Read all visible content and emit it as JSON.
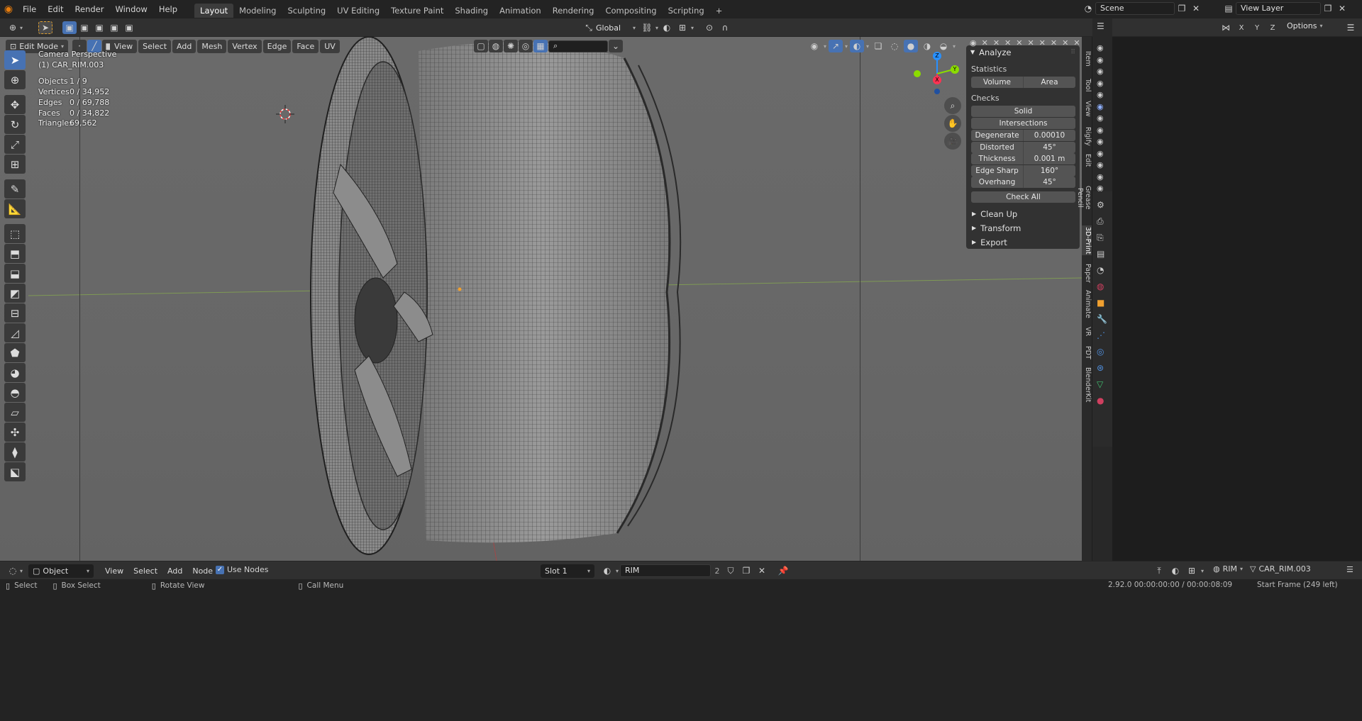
{
  "topbar": {
    "menus": [
      "File",
      "Edit",
      "Render",
      "Window",
      "Help"
    ],
    "workspaces": [
      "Layout",
      "Modeling",
      "Sculpting",
      "UV Editing",
      "Texture Paint",
      "Shading",
      "Animation",
      "Rendering",
      "Compositing",
      "Scripting"
    ],
    "active_workspace": "Layout",
    "add_tab_icon": "+",
    "scene": "Scene",
    "view_layer": "View Layer"
  },
  "viewport_header": {
    "transform_orientation": "Global",
    "options_label": "Options",
    "axes": [
      "X",
      "Y",
      "Z"
    ]
  },
  "tool_header": {
    "mode": "Edit Mode",
    "menus": [
      "View",
      "Select",
      "Add",
      "Mesh",
      "Vertex",
      "Edge",
      "Face",
      "UV"
    ]
  },
  "overlay": {
    "camera": "Camera Perspective",
    "object": "(1) CAR_RIM.003",
    "stats": [
      {
        "label": "Objects",
        "value": "1 / 9"
      },
      {
        "label": "Vertices",
        "value": "0 / 34,952"
      },
      {
        "label": "Edges",
        "value": "0 / 69,788"
      },
      {
        "label": "Faces",
        "value": "0 / 34,822"
      },
      {
        "label": "Triangles",
        "value": "69,562"
      }
    ]
  },
  "npanel": {
    "title": "Analyze",
    "statistics_label": "Statistics",
    "volume_btn": "Volume",
    "area_btn": "Area",
    "checks_label": "Checks",
    "solid_btn": "Solid",
    "intersections_btn": "Intersections",
    "checks": [
      {
        "label": "Degenerate",
        "value": "0.00010"
      },
      {
        "label": "Distorted",
        "value": "45°"
      },
      {
        "label": "Thickness",
        "value": "0.001 m"
      },
      {
        "label": "Edge Sharp",
        "value": "160°"
      },
      {
        "label": "Overhang",
        "value": "45°"
      }
    ],
    "check_all_btn": "Check All",
    "sections": [
      "Clean Up",
      "Transform",
      "Export"
    ]
  },
  "side_tabs": [
    "Item",
    "Tool",
    "View",
    "Rigify",
    "Edit",
    "Grease Pencil",
    "3D-Print",
    "Paper",
    "Animate",
    "VR",
    "PDT",
    "BlenderKit"
  ],
  "active_side_tab": "3D-Print",
  "gizmo": {
    "z": "Z",
    "y": "Y",
    "x": "X"
  },
  "bottom_header": {
    "editor": "Object",
    "menus": [
      "View",
      "Select",
      "Add",
      "Node"
    ],
    "use_nodes_label": "Use Nodes",
    "use_nodes_checked": true,
    "slot": "Slot 1",
    "material": "RIM",
    "material_users": "2",
    "right_material": "RIM",
    "right_object": "CAR_RIM.003"
  },
  "statusbar": {
    "select": "Select",
    "box_select": "Box Select",
    "rotate_view": "Rotate View",
    "call_menu": "Call Menu",
    "version_time": "2.92.0  00:00:00:00 / 00:00:08:09",
    "frame": "Start Frame (249 left)"
  },
  "colors": {
    "accent": "#4772b3",
    "viewport_bg": "#686868",
    "axis_x": "#ff3352",
    "axis_y": "#8bdc00",
    "axis_z": "#2890ff"
  }
}
